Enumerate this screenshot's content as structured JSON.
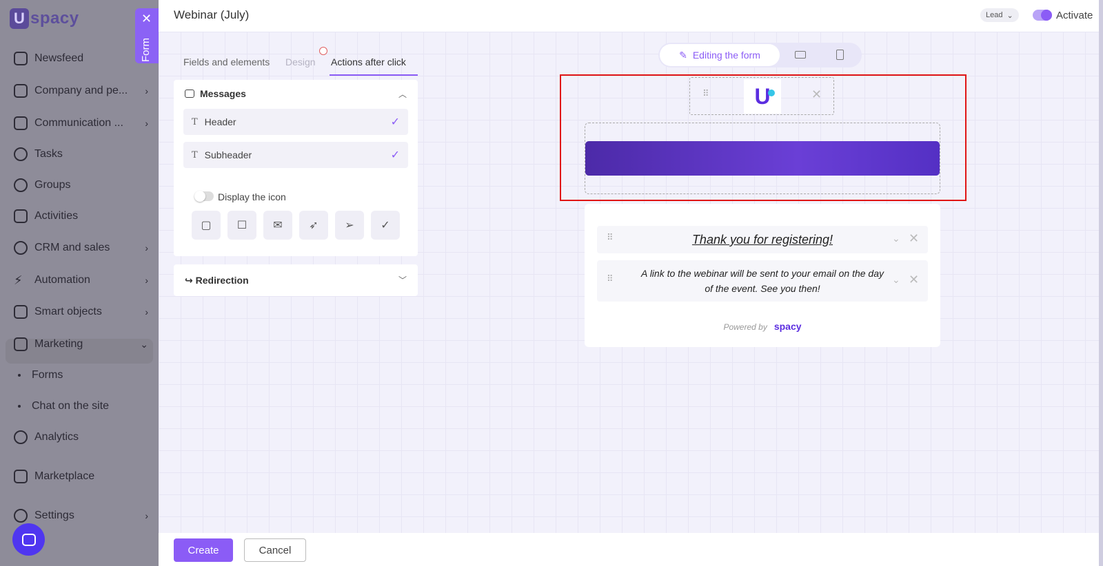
{
  "sidebar": {
    "brand": "spacy",
    "items": [
      {
        "label": "Newsfeed",
        "icon": "home-icon"
      },
      {
        "label": "Company and pe...",
        "icon": "company-icon",
        "chevron": true
      },
      {
        "label": "Communication ...",
        "icon": "communication-icon",
        "chevron": true
      },
      {
        "label": "Tasks",
        "icon": "tasks-icon"
      },
      {
        "label": "Groups",
        "icon": "groups-icon"
      },
      {
        "label": "Activities",
        "icon": "calendar-icon"
      },
      {
        "label": "CRM and sales",
        "icon": "crm-icon",
        "chevron": true
      },
      {
        "label": "Automation",
        "icon": "lightning-icon",
        "chevron": true
      },
      {
        "label": "Smart objects",
        "icon": "smart-objects-icon",
        "chevron": true
      },
      {
        "label": "Marketing",
        "icon": "marketing-icon",
        "chevron": true
      },
      {
        "label": "Analytics",
        "icon": "analytics-icon"
      },
      {
        "label": "Marketplace",
        "icon": "marketplace-icon"
      },
      {
        "label": "Settings",
        "icon": "gear-icon",
        "chevron": true
      }
    ],
    "sub_items": [
      "Forms",
      "Chat on the site"
    ]
  },
  "form_tab": {
    "label": "Form",
    "close": "✕"
  },
  "header": {
    "title": "Webinar (July)",
    "lead": "Lead",
    "activate": "Activate"
  },
  "tabs": [
    "Fields and elements",
    "Design",
    "Actions after click"
  ],
  "messages": {
    "title": "Messages",
    "fields": [
      "Header",
      "Subheader"
    ],
    "check": "✓",
    "toggle_label": "Display the icon",
    "icons": [
      "clipboard-icon",
      "chat-check-icon",
      "mail-icon",
      "rocket-icon",
      "send-icon",
      "check-icon"
    ]
  },
  "redirection": {
    "title": "Redirection"
  },
  "preview": {
    "edit_label": "Editing the form",
    "thank_you": "Thank you for registering!",
    "link_text": "A link to the webinar will be sent to your email on the day of the event. See you then!",
    "powered_by": "Powered by",
    "powered_brand": "spacy"
  },
  "footer": {
    "create": "Create",
    "cancel": "Cancel"
  }
}
